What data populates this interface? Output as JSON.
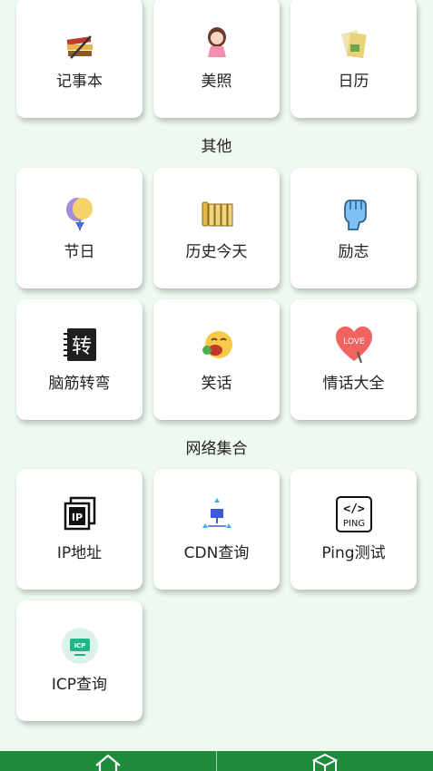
{
  "sections": [
    {
      "title": "",
      "items": [
        {
          "label": "记事本",
          "icon": "notebook-icon"
        },
        {
          "label": "美照",
          "icon": "girl-photo-icon"
        },
        {
          "label": "日历",
          "icon": "calendar-icon"
        }
      ]
    },
    {
      "title": "其他",
      "items": [
        {
          "label": "节日",
          "icon": "balloon-icon"
        },
        {
          "label": "历史今天",
          "icon": "bamboo-scroll-icon"
        },
        {
          "label": "励志",
          "icon": "fist-icon"
        },
        {
          "label": "脑筋转弯",
          "icon": "brain-turn-icon"
        },
        {
          "label": "笑话",
          "icon": "laughing-face-icon"
        },
        {
          "label": "情话大全",
          "icon": "love-heart-icon"
        }
      ]
    },
    {
      "title": "网络集合",
      "items": [
        {
          "label": "IP地址",
          "icon": "ip-icon"
        },
        {
          "label": "CDN查询",
          "icon": "cdn-network-icon"
        },
        {
          "label": "Ping测试",
          "icon": "ping-icon"
        },
        {
          "label": "ICP查询",
          "icon": "icp-icon"
        }
      ]
    }
  ],
  "icon_text": {
    "brain_char": "转",
    "love_text": "LOVE",
    "ip_text": "IP",
    "ping_code": "</>",
    "ping_text": "PING",
    "icp_text": "ICP"
  },
  "tabbar": {
    "color": "#1f8a3c",
    "tabs": [
      {
        "icon": "home-icon"
      },
      {
        "icon": "cube-icon"
      }
    ]
  }
}
